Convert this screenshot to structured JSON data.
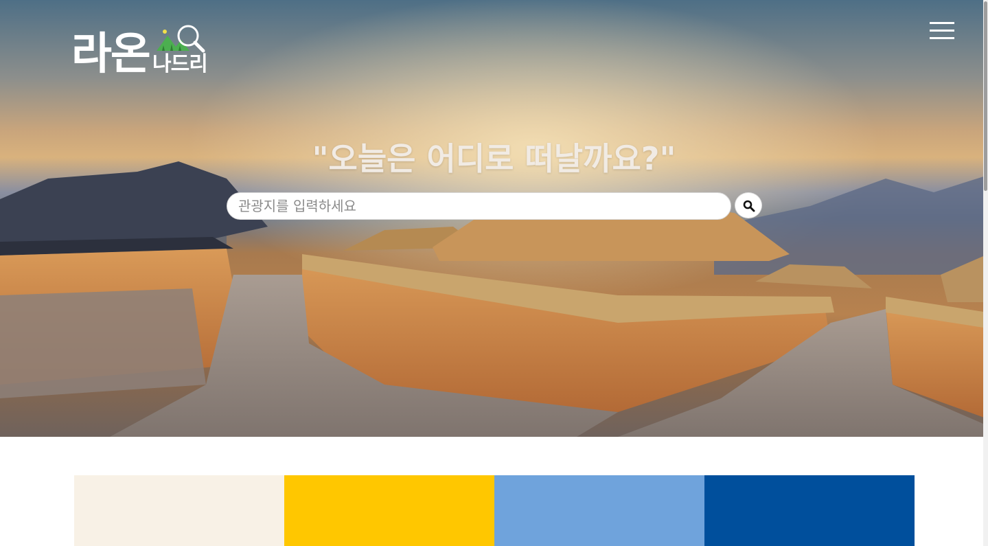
{
  "app": {
    "logo_main": "라온",
    "logo_sub": "나드리"
  },
  "header": {
    "menu_icon": "hamburger-menu-icon"
  },
  "hero": {
    "headline": "\"오늘은 어디로 떠날까요?\"",
    "image_description_icon": "hanok-village-scene"
  },
  "search": {
    "placeholder": "관광지를 입력하세요",
    "value": "",
    "button_icon": "search-icon"
  },
  "palette": {
    "colors": [
      "#f8f1e6",
      "#ffc700",
      "#6fa3dc",
      "#004f9c"
    ]
  },
  "colors": {
    "accent_green": "#4caf50",
    "white": "#ffffff"
  }
}
